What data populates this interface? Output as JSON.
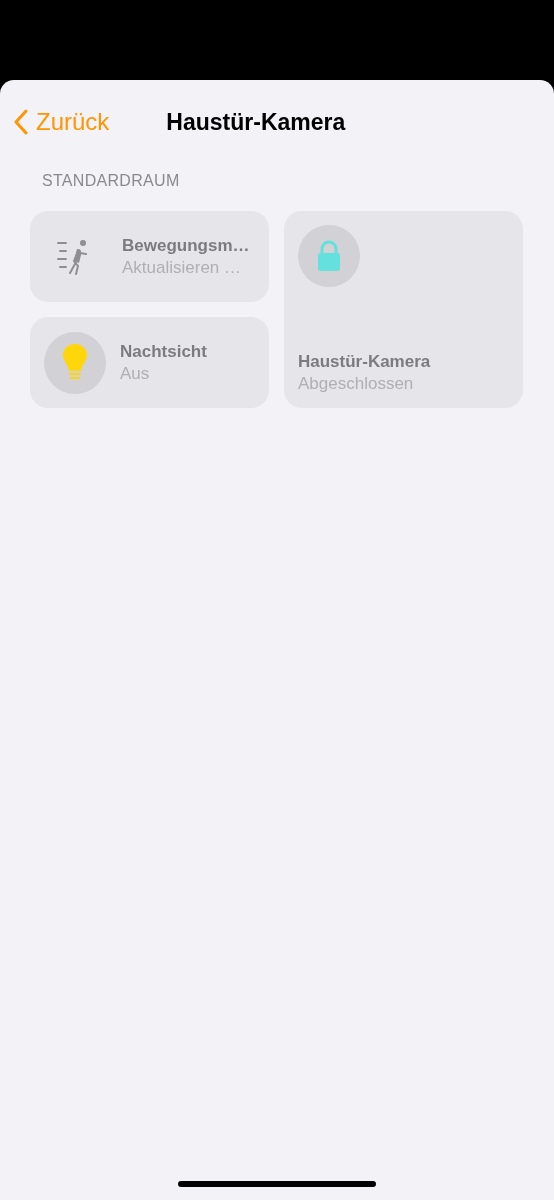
{
  "nav": {
    "back": "Zurück",
    "title": "Haustür-Kamera"
  },
  "section": {
    "title": "STANDARDRAUM",
    "tiles": [
      {
        "kind": "motion",
        "name": "Bewegungsm…",
        "status": "Aktualisieren …"
      },
      {
        "kind": "lock",
        "name": "Haustür-Kamera",
        "status": "Abgeschlossen"
      },
      {
        "kind": "light",
        "name": "Nachtsicht",
        "status": "Aus"
      }
    ]
  }
}
